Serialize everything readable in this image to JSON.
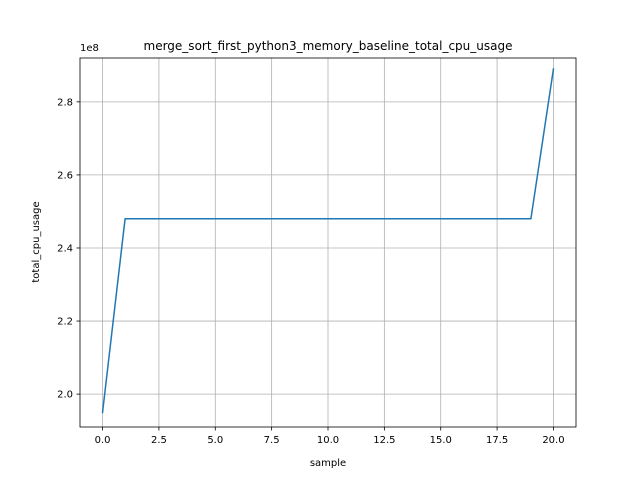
{
  "chart_data": {
    "type": "line",
    "title": "merge_sort_first_python3_memory_baseline_total_cpu_usage",
    "xlabel": "sample",
    "ylabel": "total_cpu_usage",
    "offset_text": "1e8",
    "xlim": [
      -1.0,
      21.0
    ],
    "ylim": [
      1.91,
      2.92
    ],
    "y_multiplier": 100000000,
    "grid": true,
    "xticks": [
      0.0,
      2.5,
      5.0,
      7.5,
      10.0,
      12.5,
      15.0,
      17.5,
      20.0
    ],
    "xtick_labels": [
      "0.0",
      "2.5",
      "5.0",
      "7.5",
      "10.0",
      "12.5",
      "15.0",
      "17.5",
      "20.0"
    ],
    "yticks": [
      2.0,
      2.2,
      2.4,
      2.6,
      2.8
    ],
    "ytick_labels": [
      "2.0",
      "2.2",
      "2.4",
      "2.6",
      "2.8"
    ],
    "series": [
      {
        "color": "#1f77b4",
        "x": [
          0,
          1,
          2,
          3,
          4,
          5,
          6,
          7,
          8,
          9,
          10,
          11,
          12,
          13,
          14,
          15,
          16,
          17,
          18,
          19,
          20
        ],
        "y": [
          1.95,
          2.48,
          2.48,
          2.48,
          2.48,
          2.48,
          2.48,
          2.48,
          2.48,
          2.48,
          2.48,
          2.48,
          2.48,
          2.48,
          2.48,
          2.48,
          2.48,
          2.48,
          2.48,
          2.48,
          2.89
        ]
      }
    ]
  }
}
